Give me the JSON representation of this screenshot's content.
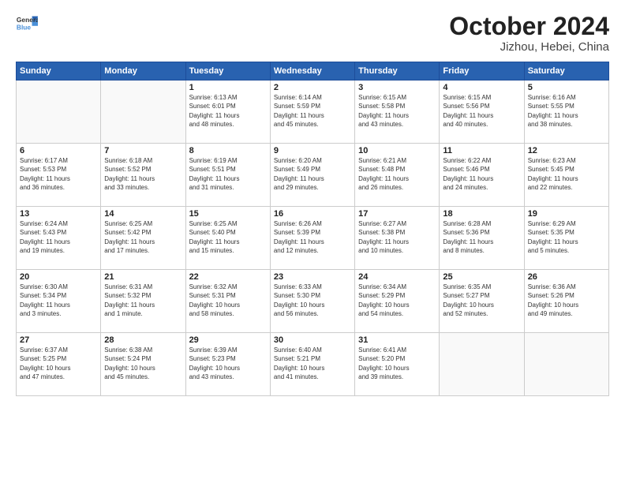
{
  "header": {
    "logo": {
      "line1": "General",
      "line2": "Blue"
    },
    "title": "October 2024",
    "subtitle": "Jizhou, Hebei, China"
  },
  "weekdays": [
    "Sunday",
    "Monday",
    "Tuesday",
    "Wednesday",
    "Thursday",
    "Friday",
    "Saturday"
  ],
  "weeks": [
    [
      {
        "day": "",
        "info": ""
      },
      {
        "day": "",
        "info": ""
      },
      {
        "day": "1",
        "info": "Sunrise: 6:13 AM\nSunset: 6:01 PM\nDaylight: 11 hours\nand 48 minutes."
      },
      {
        "day": "2",
        "info": "Sunrise: 6:14 AM\nSunset: 5:59 PM\nDaylight: 11 hours\nand 45 minutes."
      },
      {
        "day": "3",
        "info": "Sunrise: 6:15 AM\nSunset: 5:58 PM\nDaylight: 11 hours\nand 43 minutes."
      },
      {
        "day": "4",
        "info": "Sunrise: 6:15 AM\nSunset: 5:56 PM\nDaylight: 11 hours\nand 40 minutes."
      },
      {
        "day": "5",
        "info": "Sunrise: 6:16 AM\nSunset: 5:55 PM\nDaylight: 11 hours\nand 38 minutes."
      }
    ],
    [
      {
        "day": "6",
        "info": "Sunrise: 6:17 AM\nSunset: 5:53 PM\nDaylight: 11 hours\nand 36 minutes."
      },
      {
        "day": "7",
        "info": "Sunrise: 6:18 AM\nSunset: 5:52 PM\nDaylight: 11 hours\nand 33 minutes."
      },
      {
        "day": "8",
        "info": "Sunrise: 6:19 AM\nSunset: 5:51 PM\nDaylight: 11 hours\nand 31 minutes."
      },
      {
        "day": "9",
        "info": "Sunrise: 6:20 AM\nSunset: 5:49 PM\nDaylight: 11 hours\nand 29 minutes."
      },
      {
        "day": "10",
        "info": "Sunrise: 6:21 AM\nSunset: 5:48 PM\nDaylight: 11 hours\nand 26 minutes."
      },
      {
        "day": "11",
        "info": "Sunrise: 6:22 AM\nSunset: 5:46 PM\nDaylight: 11 hours\nand 24 minutes."
      },
      {
        "day": "12",
        "info": "Sunrise: 6:23 AM\nSunset: 5:45 PM\nDaylight: 11 hours\nand 22 minutes."
      }
    ],
    [
      {
        "day": "13",
        "info": "Sunrise: 6:24 AM\nSunset: 5:43 PM\nDaylight: 11 hours\nand 19 minutes."
      },
      {
        "day": "14",
        "info": "Sunrise: 6:25 AM\nSunset: 5:42 PM\nDaylight: 11 hours\nand 17 minutes."
      },
      {
        "day": "15",
        "info": "Sunrise: 6:25 AM\nSunset: 5:40 PM\nDaylight: 11 hours\nand 15 minutes."
      },
      {
        "day": "16",
        "info": "Sunrise: 6:26 AM\nSunset: 5:39 PM\nDaylight: 11 hours\nand 12 minutes."
      },
      {
        "day": "17",
        "info": "Sunrise: 6:27 AM\nSunset: 5:38 PM\nDaylight: 11 hours\nand 10 minutes."
      },
      {
        "day": "18",
        "info": "Sunrise: 6:28 AM\nSunset: 5:36 PM\nDaylight: 11 hours\nand 8 minutes."
      },
      {
        "day": "19",
        "info": "Sunrise: 6:29 AM\nSunset: 5:35 PM\nDaylight: 11 hours\nand 5 minutes."
      }
    ],
    [
      {
        "day": "20",
        "info": "Sunrise: 6:30 AM\nSunset: 5:34 PM\nDaylight: 11 hours\nand 3 minutes."
      },
      {
        "day": "21",
        "info": "Sunrise: 6:31 AM\nSunset: 5:32 PM\nDaylight: 11 hours\nand 1 minute."
      },
      {
        "day": "22",
        "info": "Sunrise: 6:32 AM\nSunset: 5:31 PM\nDaylight: 10 hours\nand 58 minutes."
      },
      {
        "day": "23",
        "info": "Sunrise: 6:33 AM\nSunset: 5:30 PM\nDaylight: 10 hours\nand 56 minutes."
      },
      {
        "day": "24",
        "info": "Sunrise: 6:34 AM\nSunset: 5:29 PM\nDaylight: 10 hours\nand 54 minutes."
      },
      {
        "day": "25",
        "info": "Sunrise: 6:35 AM\nSunset: 5:27 PM\nDaylight: 10 hours\nand 52 minutes."
      },
      {
        "day": "26",
        "info": "Sunrise: 6:36 AM\nSunset: 5:26 PM\nDaylight: 10 hours\nand 49 minutes."
      }
    ],
    [
      {
        "day": "27",
        "info": "Sunrise: 6:37 AM\nSunset: 5:25 PM\nDaylight: 10 hours\nand 47 minutes."
      },
      {
        "day": "28",
        "info": "Sunrise: 6:38 AM\nSunset: 5:24 PM\nDaylight: 10 hours\nand 45 minutes."
      },
      {
        "day": "29",
        "info": "Sunrise: 6:39 AM\nSunset: 5:23 PM\nDaylight: 10 hours\nand 43 minutes."
      },
      {
        "day": "30",
        "info": "Sunrise: 6:40 AM\nSunset: 5:21 PM\nDaylight: 10 hours\nand 41 minutes."
      },
      {
        "day": "31",
        "info": "Sunrise: 6:41 AM\nSunset: 5:20 PM\nDaylight: 10 hours\nand 39 minutes."
      },
      {
        "day": "",
        "info": ""
      },
      {
        "day": "",
        "info": ""
      }
    ]
  ]
}
